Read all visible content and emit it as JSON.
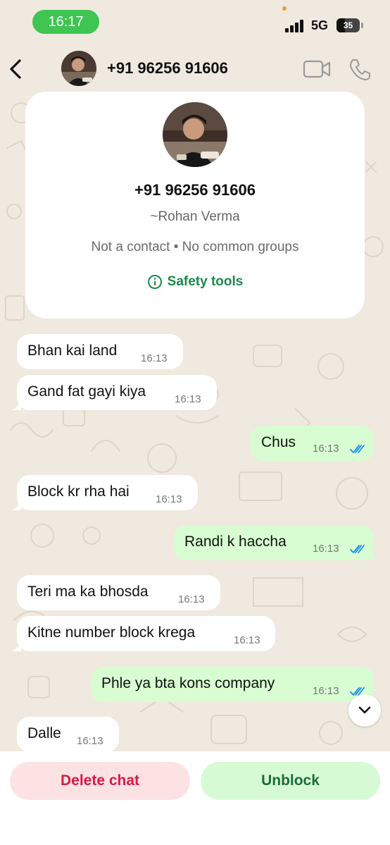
{
  "status_bar": {
    "time": "16:17",
    "network": "5G",
    "battery": "35",
    "battery_percent": 35,
    "time_pill_color": "#3ec552"
  },
  "header": {
    "title": "+91 96256 91606",
    "back_icon": "chevron-left-icon",
    "video_icon": "video-camera-icon",
    "call_icon": "phone-icon"
  },
  "profile": {
    "phone": "+91 96256 91606",
    "name": "~Rohan Verma",
    "info": "Not a contact • No common groups",
    "safety_label": "Safety tools",
    "safety_icon": "info-circle-icon"
  },
  "messages": [
    {
      "dir": "in",
      "text": "Bhan kai land",
      "time": "16:13"
    },
    {
      "dir": "in",
      "text": "Gand fat gayi kiya",
      "time": "16:13"
    },
    {
      "dir": "out",
      "text": "Chus",
      "time": "16:13",
      "status": "read"
    },
    {
      "dir": "in",
      "text": "Block kr rha hai",
      "time": "16:13"
    },
    {
      "dir": "out",
      "text": "Randi k haccha",
      "time": "16:13",
      "status": "read"
    },
    {
      "dir": "in",
      "text": "Teri ma ka bhosda",
      "time": "16:13"
    },
    {
      "dir": "in",
      "text": "Kitne number block krega",
      "time": "16:13"
    },
    {
      "dir": "out",
      "text": "Phle ya bta kons company",
      "time": "16:13",
      "status": "read"
    },
    {
      "dir": "in",
      "text": "Dalle",
      "time": "16:13"
    }
  ],
  "actions": {
    "delete_label": "Delete chat",
    "unblock_label": "Unblock"
  },
  "colors": {
    "outgoing_bubble": "#d8fdd2",
    "incoming_bubble": "#ffffff",
    "read_ticks": "#1a8cf0",
    "danger": "#d71a45",
    "accent_green": "#1a8a4c"
  }
}
